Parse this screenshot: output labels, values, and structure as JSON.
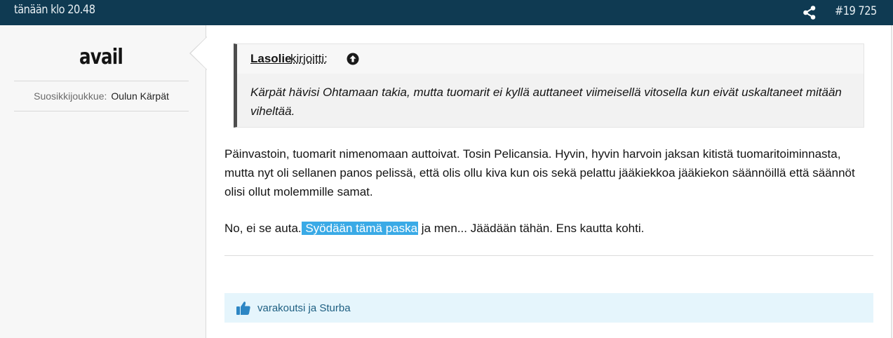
{
  "topbar": {
    "timestamp": "tänään klo 20.48",
    "share_icon": "share-icon",
    "post_number": "#19 725"
  },
  "sidebar": {
    "username": "avail",
    "favorite_label": "Suosikkijoukkue:",
    "favorite_value": "Oulun Kärpät"
  },
  "quote": {
    "author": "Lasolie",
    "wrote": "kirjoitti:",
    "jump_icon": "arrow-up-circle-icon",
    "text": "Kärpät hävisi Ohtamaan takia, mutta tuomarit ei kyllä auttaneet viimeisellä vitosella kun eivät uskaltaneet mitään viheltää."
  },
  "post": {
    "paragraph1": "Päinvastoin, tuomarit nimenomaan auttoivat. Tosin Pelicansia. Hyvin, hyvin harvoin jaksan kitistä tuomaritoiminnasta, mutta nyt oli sellanen panos pelissä, että olis ollu kiva kun ois sekä pelattu jääkiekkoa jääkiekon säännöillä että säännöt olisi ollut molemmille samat.",
    "paragraph2_before": "No, ei se auta.",
    "paragraph2_highlight": " Syödään tämä paska",
    "paragraph2_after": " ja men... Jäädään tähän. Ens kautta kohti."
  },
  "likes": {
    "icon": "thumbs-up-icon",
    "text": "varakoutsi ja Sturba"
  },
  "colors": {
    "topbar": "#0f3a52",
    "highlight": "#3aaae6",
    "likes_bg": "#e5f5fc",
    "thumb": "#2d86c4"
  }
}
